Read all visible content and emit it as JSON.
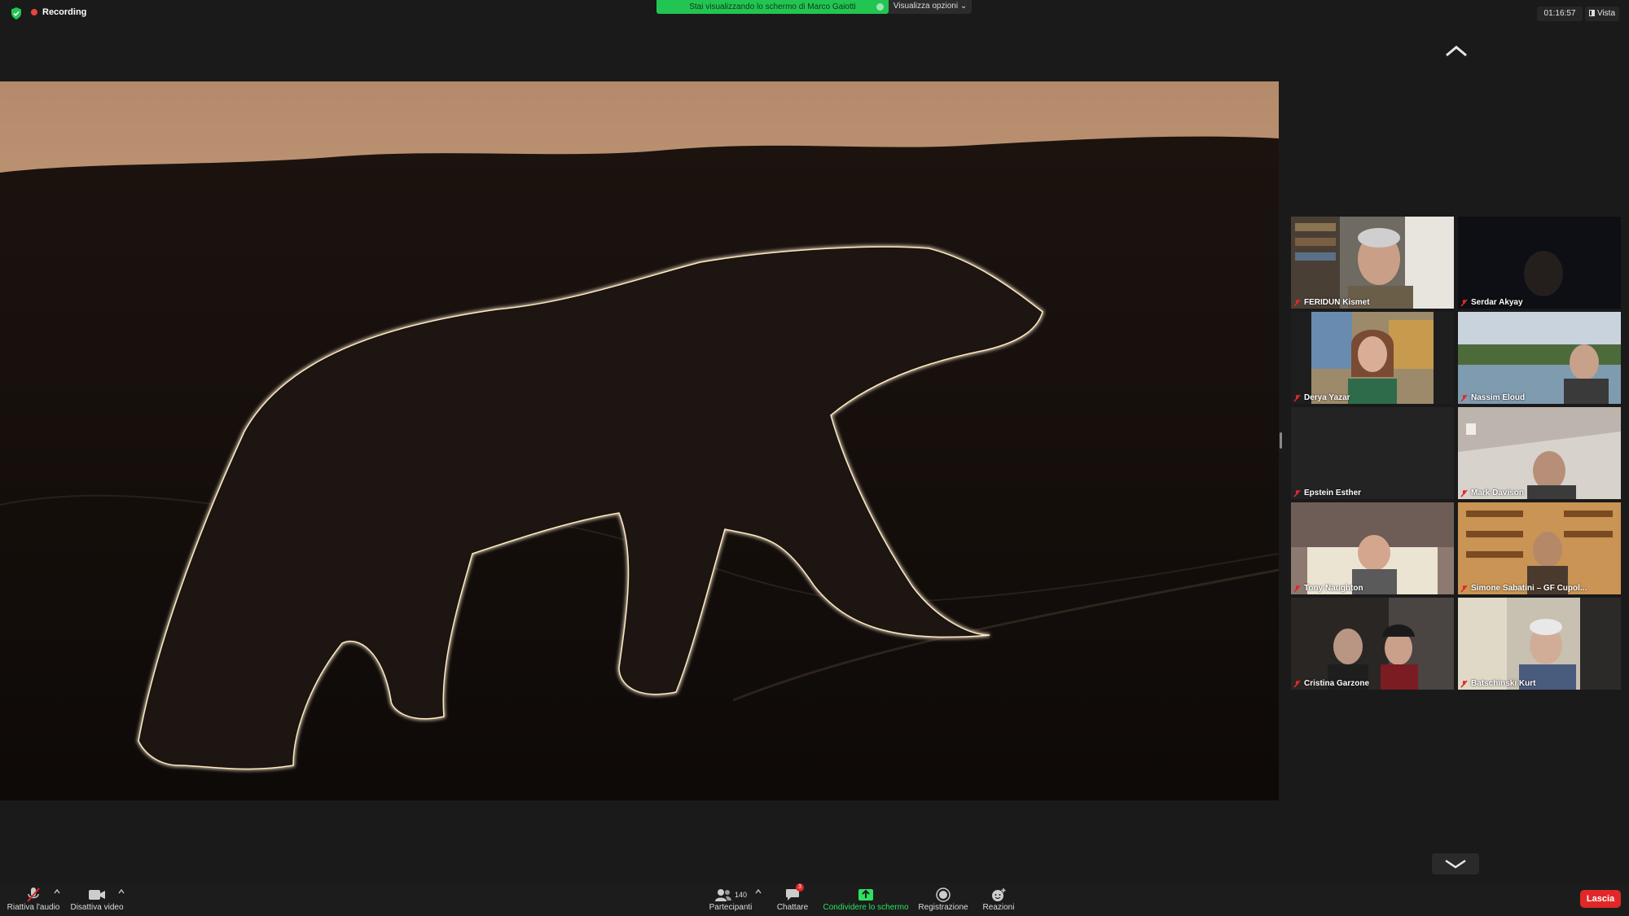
{
  "status": {
    "recording_label": "Recording",
    "share_banner": "Stai visualizzando lo schermo di Marco Gaiotti",
    "view_options": "Visualizza opzioni",
    "timer": "01:16:57",
    "view_button": "Vista"
  },
  "colors": {
    "banner_green": "#23c552",
    "leave_red": "#e02828",
    "toolbar_bg": "#1c1c1c",
    "share_green": "#2ee05f"
  },
  "participants": [
    {
      "name": "FERIDUN Kismet",
      "muted": true
    },
    {
      "name": "Serdar Akyay",
      "muted": true
    },
    {
      "name": "Derya Yazar",
      "muted": true
    },
    {
      "name": "Nassim Eloud",
      "muted": true
    },
    {
      "name": "Epstein Esther",
      "muted": true
    },
    {
      "name": "Mark Davison",
      "muted": true
    },
    {
      "name": "Tony Naughton",
      "muted": true
    },
    {
      "name": "Simone Sabatini – GF Cupol...",
      "muted": true
    },
    {
      "name": "Cristina Garzone",
      "muted": true
    },
    {
      "name": "Batschinski Kurt",
      "muted": true
    }
  ],
  "toolbar": {
    "unmute": "Riattiva l'audio",
    "video": "Disattiva video",
    "participants": "Partecipanti",
    "participant_count": "140",
    "chat": "Chattare",
    "chat_badge": "3",
    "share": "Condividere lo schermo",
    "record": "Registrazione",
    "reactions": "Reazioni",
    "leave": "Lascia"
  }
}
